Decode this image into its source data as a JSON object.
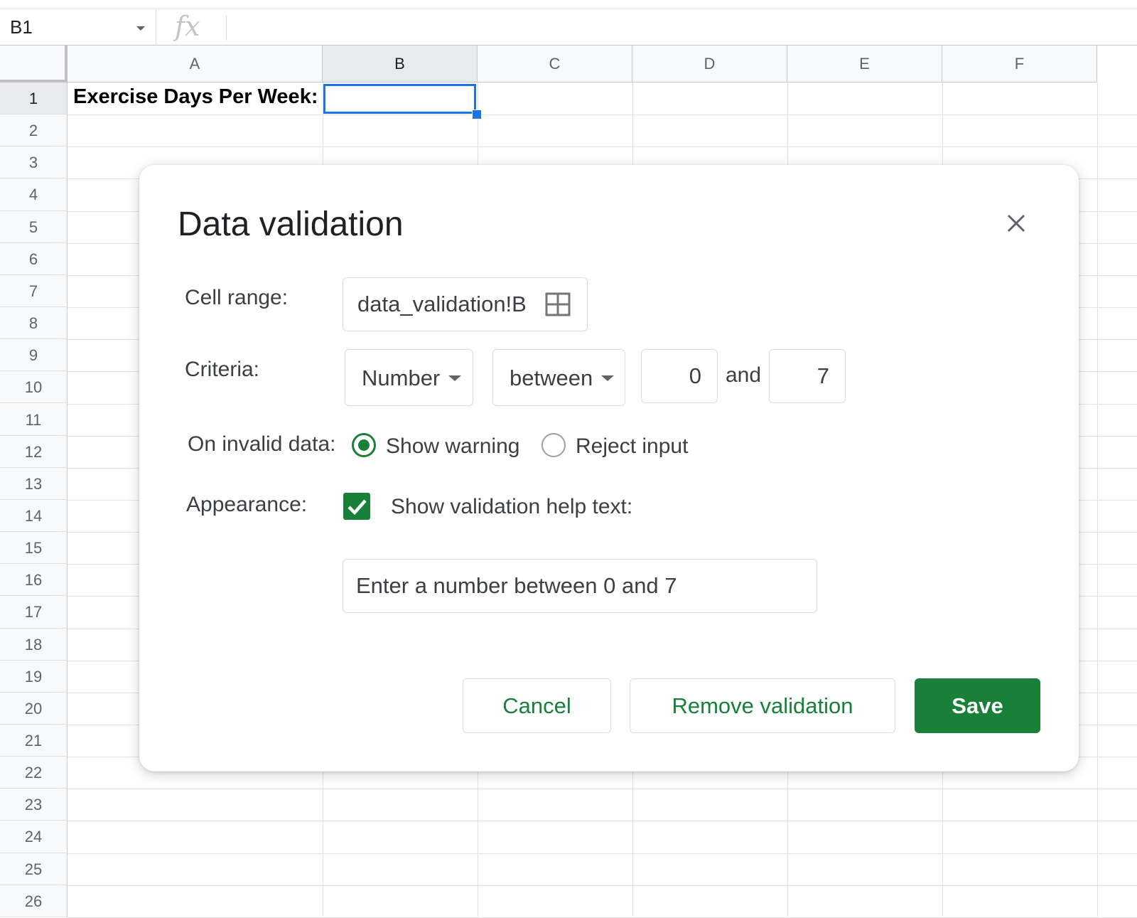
{
  "formula_bar": {
    "name_box": "B1",
    "fx_label": "fx",
    "formula_value": ""
  },
  "sheet": {
    "columns": [
      "A",
      "B",
      "C",
      "D",
      "E",
      "F"
    ],
    "rows": [
      "1",
      "2",
      "3",
      "4",
      "5",
      "6",
      "7",
      "8",
      "9",
      "10",
      "11",
      "12",
      "13",
      "14",
      "15",
      "16",
      "17",
      "18",
      "19",
      "20",
      "21",
      "22",
      "23",
      "24",
      "25",
      "26"
    ],
    "selected_column": "B",
    "selected_row": "1",
    "cells": {
      "A1": "Exercise Days Per Week:",
      "B1": ""
    }
  },
  "dialog": {
    "title": "Data validation",
    "cell_range": {
      "label": "Cell range:",
      "value": "data_validation!B"
    },
    "criteria": {
      "label": "Criteria:",
      "type": "Number",
      "operator": "between",
      "min": "0",
      "and_label": "and",
      "max": "7"
    },
    "invalid_data": {
      "label": "On invalid data:",
      "options": [
        "Show warning",
        "Reject input"
      ],
      "selected": "Show warning"
    },
    "appearance": {
      "label": "Appearance:",
      "checkbox_label": "Show validation help text:",
      "checked": true,
      "help_text": "Enter a number between 0 and 7"
    },
    "buttons": {
      "cancel": "Cancel",
      "remove": "Remove validation",
      "save": "Save"
    }
  },
  "colors": {
    "accent_green": "#188038",
    "selection_blue": "#1a73e8"
  }
}
